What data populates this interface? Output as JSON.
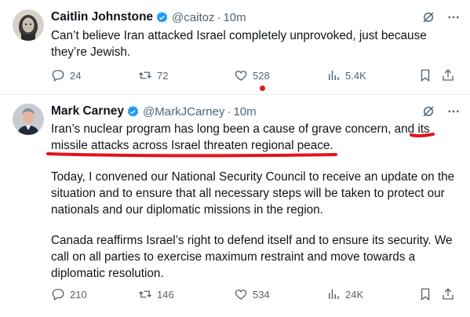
{
  "colors": {
    "verified": "#1d9bf0",
    "muted": "#536471",
    "text": "#0f1419",
    "annotation": "#e3141b"
  },
  "tweets": [
    {
      "name": "Caitlin Johnstone",
      "handle": "@caitoz",
      "dot": "·",
      "time": "10m",
      "verified_icon": "verified-badge-icon",
      "lines": [
        "Can’t believe Iran attacked Israel completely unprovoked, just because",
        "they’re Jewish."
      ],
      "stats": {
        "replies": "24",
        "retweets": "72",
        "likes": "528",
        "views": "5.4K"
      }
    },
    {
      "name": "Mark Carney",
      "handle": "@MarkJCarney",
      "dot": "·",
      "time": "10m",
      "verified_icon": "verified-badge-icon",
      "paragraphs": [
        [
          "Iran’s nuclear program has long been a cause of grave concern, and its",
          "missile attacks across Israel threaten regional peace."
        ],
        [
          "Today, I convened our National Security Council to receive an update on the",
          "situation and to ensure that all necessary steps will be taken to protect our",
          "nationals and our diplomatic missions in the region."
        ],
        [
          "Canada reaffirms Israel’s right to defend itself and to ensure its security. We",
          "call on all parties to exercise maximum restraint and move towards a",
          "diplomatic resolution."
        ]
      ],
      "stats": {
        "replies": "210",
        "retweets": "146",
        "likes": "534",
        "views": "24K"
      }
    }
  ]
}
